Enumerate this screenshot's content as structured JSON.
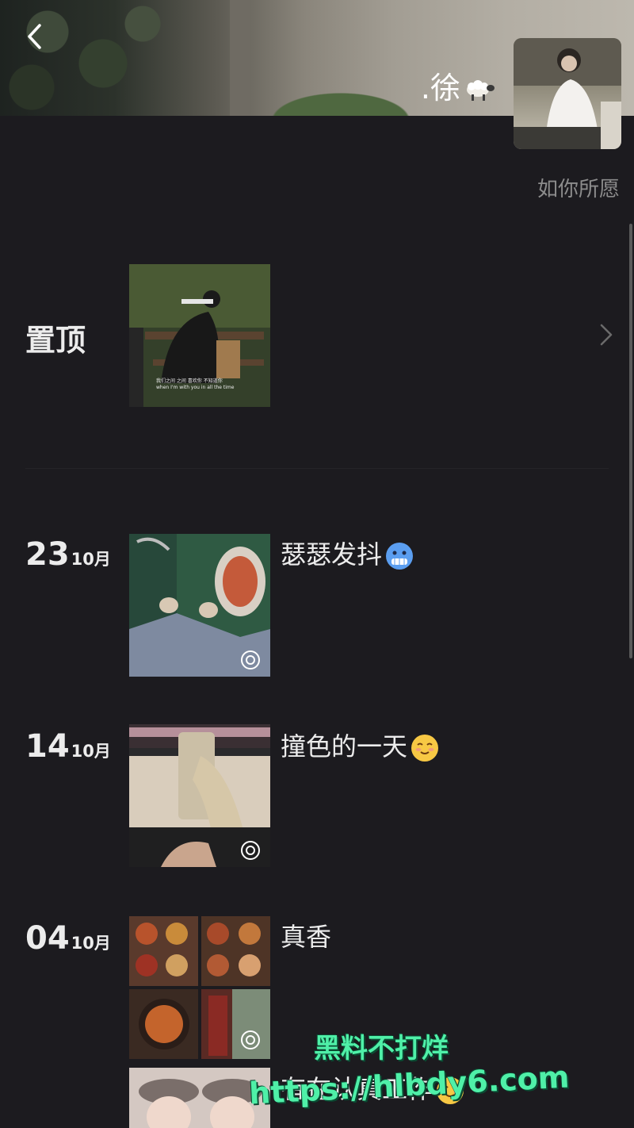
{
  "header": {
    "nickname": ".徐",
    "sheep_icon": "sheep-emoji",
    "signature": "如你所愿"
  },
  "pinned": {
    "label": "置顶",
    "thumbnail_caption": "我们之间 之间 喜欢你 不知道你",
    "thumbnail_caption_2": "when I'm with you in all the time"
  },
  "posts": [
    {
      "day": "23",
      "month": "10月",
      "caption": "瑟瑟发抖",
      "emoji": "freezing-face"
    },
    {
      "day": "14",
      "month": "10月",
      "caption": "撞色的一天",
      "emoji": "smiling-face"
    },
    {
      "day": "04",
      "month": "10月",
      "caption": "真香",
      "emoji": ""
    }
  ],
  "partial_post": {
    "caption": "有在认真工作",
    "emoji": "smiling-face"
  },
  "watermark": {
    "line1": "黑料不打烊",
    "line2": "https://hlbdy6.com"
  },
  "colors": {
    "background": "#1c1b1f",
    "text": "#ececec",
    "muted": "#8c8c8c",
    "watermark": "#4ff0a8"
  }
}
